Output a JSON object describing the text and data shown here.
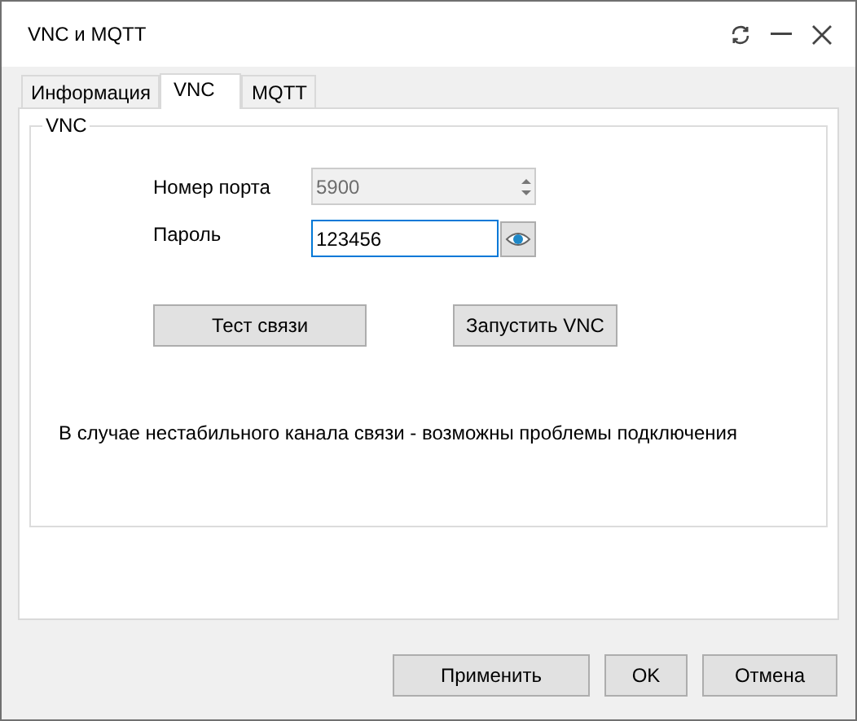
{
  "window": {
    "title": "VNC и MQTT"
  },
  "tabs": [
    {
      "label": "Информация",
      "selected": false
    },
    {
      "label": "VNC",
      "selected": true
    },
    {
      "label": "MQTT",
      "selected": false
    }
  ],
  "group": {
    "title": "VNC"
  },
  "port": {
    "label": "Номер порта",
    "value": "5900",
    "disabled": true
  },
  "password": {
    "label": "Пароль",
    "value": "123456",
    "focused": true
  },
  "actions": [
    "Тест связи",
    "Запустить VNC"
  ],
  "message": "В случае нестабильного канала связи - возможны проблемы подключения",
  "buttons": [
    "Применить",
    "OK",
    "Отмена"
  ]
}
